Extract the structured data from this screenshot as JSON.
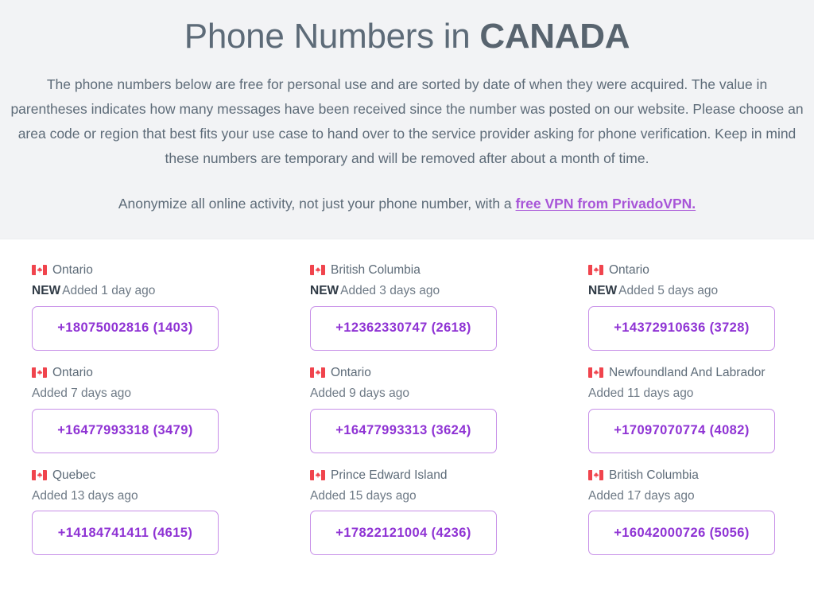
{
  "header": {
    "title_prefix": "Phone Numbers in ",
    "title_country": "CANADA",
    "intro": "The phone numbers below are free for personal use and are sorted by date of when they were acquired. The value in parentheses indicates how many messages have been received since the number was posted on our website. Please choose an area code or region that best fits your use case to hand over to the service provider asking for phone verification. Keep in mind these numbers are temporary and will be removed after about a month of time.",
    "promo_text": "Anonymize all online activity, not just your phone number, with a ",
    "promo_link_label": "free VPN from PrivadoVPN."
  },
  "labels": {
    "new_badge": "NEW",
    "flag_icon_name": "canada-flag-icon"
  },
  "colors": {
    "band_background": "#f2f3f5",
    "title": "#5d6b78",
    "body_text": "#5d6b78",
    "muted_text": "#6e7a86",
    "link": "#a855d8",
    "button_border": "#c78fe8",
    "button_text": "#8f33d4",
    "flag_red": "#f0444d"
  },
  "cards": [
    {
      "region": "Ontario",
      "is_new": true,
      "new_badge": "NEW",
      "added": "Added 1 day ago",
      "number_label": "+18075002816 (1403)",
      "number": "+18075002816",
      "message_count": 1403
    },
    {
      "region": "British Columbia",
      "is_new": true,
      "new_badge": "NEW",
      "added": "Added 3 days ago",
      "number_label": "+12362330747 (2618)",
      "number": "+12362330747",
      "message_count": 2618
    },
    {
      "region": "Ontario",
      "is_new": true,
      "new_badge": "NEW",
      "added": "Added 5 days ago",
      "number_label": "+14372910636 (3728)",
      "number": "+14372910636",
      "message_count": 3728
    },
    {
      "region": "Ontario",
      "is_new": false,
      "new_badge": "",
      "added": "Added 7 days ago",
      "number_label": "+16477993318 (3479)",
      "number": "+16477993318",
      "message_count": 3479
    },
    {
      "region": "Ontario",
      "is_new": false,
      "new_badge": "",
      "added": "Added 9 days ago",
      "number_label": "+16477993313 (3624)",
      "number": "+16477993313",
      "message_count": 3624
    },
    {
      "region": "Newfoundland And Labrador",
      "is_new": false,
      "new_badge": "",
      "added": "Added 11 days ago",
      "number_label": "+17097070774 (4082)",
      "number": "+17097070774",
      "message_count": 4082
    },
    {
      "region": "Quebec",
      "is_new": false,
      "new_badge": "",
      "added": "Added 13 days ago",
      "number_label": "+14184741411 (4615)",
      "number": "+14184741411",
      "message_count": 4615
    },
    {
      "region": "Prince Edward Island",
      "is_new": false,
      "new_badge": "",
      "added": "Added 15 days ago",
      "number_label": "+17822121004 (4236)",
      "number": "+17822121004",
      "message_count": 4236
    },
    {
      "region": "British Columbia",
      "is_new": false,
      "new_badge": "",
      "added": "Added 17 days ago",
      "number_label": "+16042000726 (5056)",
      "number": "+16042000726",
      "message_count": 5056
    }
  ]
}
